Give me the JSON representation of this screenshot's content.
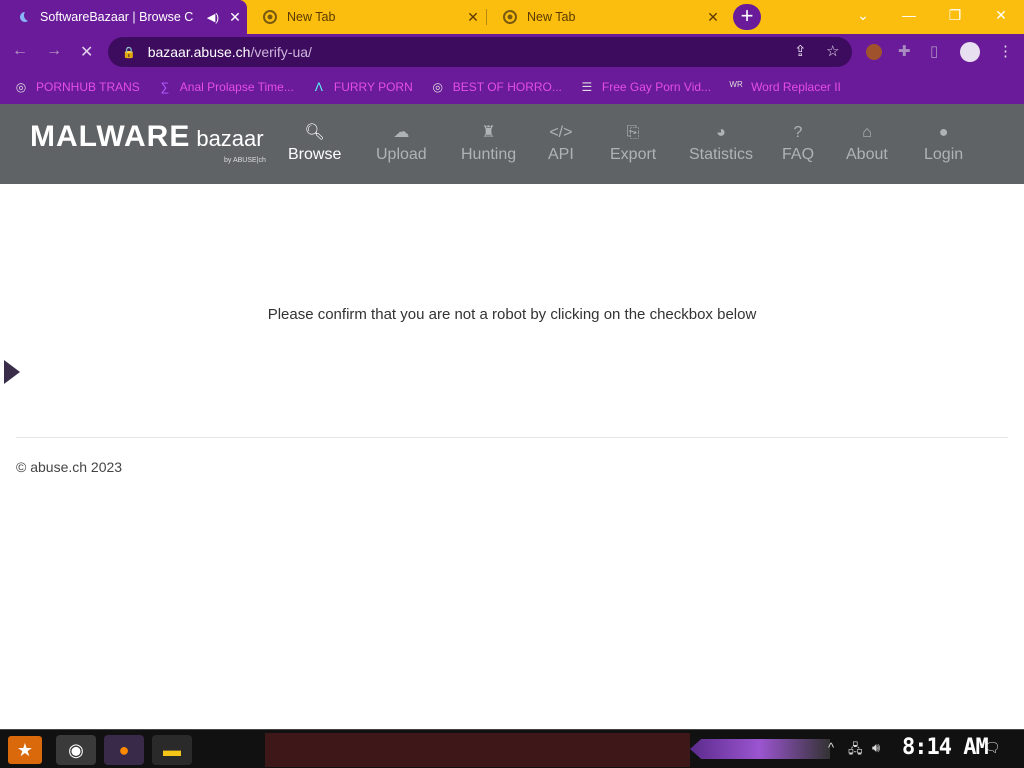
{
  "browser": {
    "tabs": [
      {
        "title": "SoftwareBazaar | Browse C",
        "active": true,
        "audio_icon": "speaker-icon"
      },
      {
        "title": "New Tab",
        "active": false
      },
      {
        "title": "New Tab",
        "active": false
      }
    ],
    "new_tab_label": "+",
    "url_host": "bazaar.abuse.ch",
    "url_path": "/verify-ua/",
    "bookmarks": [
      {
        "label": "PORNHUB TRANS",
        "icon": "globe-icon"
      },
      {
        "label": "Anal Prolapse Time...",
        "icon": "bracket-icon"
      },
      {
        "label": "FURRY PORN",
        "icon": "a-logo-icon"
      },
      {
        "label": "BEST OF HORRO...",
        "icon": "globe-icon"
      },
      {
        "label": "Free Gay Porn Vid...",
        "icon": "stack-icon"
      },
      {
        "label": "Word Replacer II",
        "icon": "wr-icon"
      }
    ],
    "accent_color": "#6a1b9a",
    "tabbar_color": "#fbbe0f"
  },
  "site": {
    "logo_main": "MALWARE",
    "logo_sub": "bazaar",
    "logo_by": "by ABUSE|ch",
    "menu": [
      {
        "label": "Browse",
        "icon": "search-icon",
        "active": true
      },
      {
        "label": "Upload",
        "icon": "cloud-upload-icon"
      },
      {
        "label": "Hunting",
        "icon": "hunting-icon"
      },
      {
        "label": "API",
        "icon": "code-icon"
      },
      {
        "label": "Export",
        "icon": "export-icon"
      },
      {
        "label": "Statistics",
        "icon": "pie-chart-icon"
      },
      {
        "label": "FAQ",
        "icon": "question-icon"
      },
      {
        "label": "About",
        "icon": "building-icon"
      },
      {
        "label": "Login",
        "icon": "user-icon"
      }
    ],
    "message": "Please confirm that you are not a robot by clicking on the checkbox below",
    "footer": "© abuse.ch 2023"
  },
  "taskbar": {
    "clock": "8:14 AM"
  }
}
